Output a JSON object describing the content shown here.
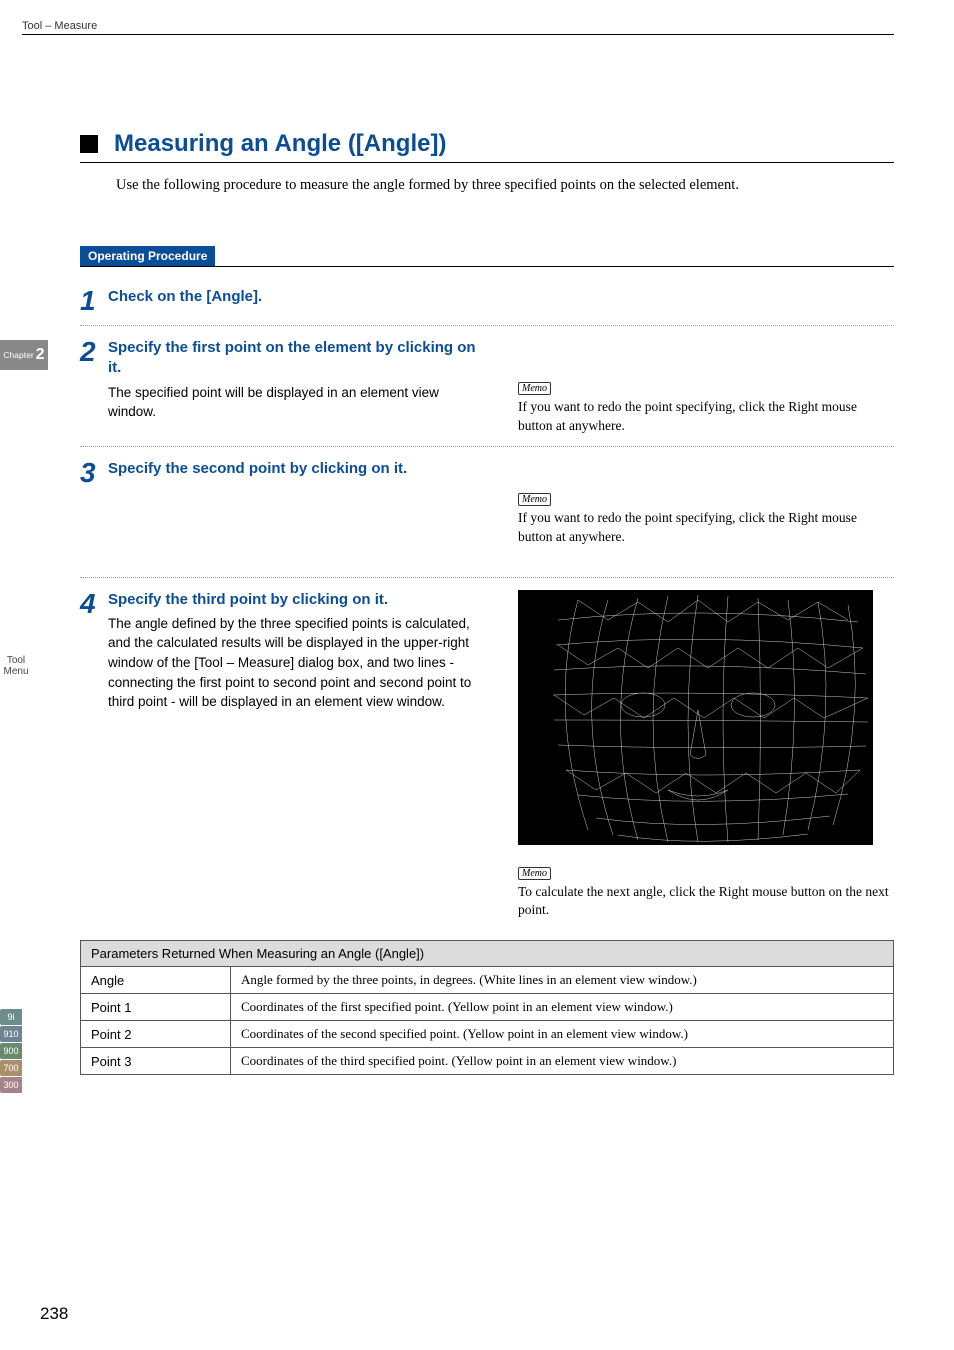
{
  "header": {
    "breadcrumb": "Tool – Measure"
  },
  "chapter_tab": {
    "label": "Chapter",
    "num": "2"
  },
  "side": {
    "menu_line1": "Tool",
    "menu_line2": "Menu",
    "tabs": [
      "9i",
      "910",
      "900",
      "700",
      "300"
    ]
  },
  "section": {
    "title": "Measuring an Angle ([Angle])"
  },
  "intro": "Use the following procedure to measure the angle formed by three specified points on the selected element.",
  "op_proc_label": "Operating Procedure",
  "memo_label": "Memo",
  "steps": [
    {
      "num": "1",
      "title": "Check on the [Angle].",
      "text": "",
      "memo": ""
    },
    {
      "num": "2",
      "title": "Specify the first point on the element by clicking on it.",
      "text": "The specified point will be displayed in an element view window.",
      "memo": "If you want to redo the point specifying, click the Right mouse button at anywhere."
    },
    {
      "num": "3",
      "title": "Specify the second point by clicking on it.",
      "text": "",
      "memo": "If you want to redo the point specifying, click the Right mouse button at anywhere."
    },
    {
      "num": "4",
      "title": "Specify the third point by clicking on it.",
      "text": "The angle defined by the three specified points is calculated, and the calculated results will be displayed in the upper-right window of the [Tool – Measure] dialog box, and two lines - connecting the first point to second point and second point to third point - will be displayed in an element view window.",
      "memo": "To calculate the next angle, click the Right mouse button on the next point."
    }
  ],
  "table": {
    "header": "Parameters Returned When Measuring an Angle ([Angle])",
    "rows": [
      {
        "label": "Angle",
        "desc": "Angle formed by the three points, in degrees. (White lines in an element view window.)"
      },
      {
        "label": "Point 1",
        "desc": "Coordinates of the first specified point. (Yellow point in an element view window.)"
      },
      {
        "label": "Point 2",
        "desc": "Coordinates of the second specified point. (Yellow point in an element view window.)"
      },
      {
        "label": "Point 3",
        "desc": "Coordinates of the third specified point. (Yellow point in an element view window.)"
      }
    ]
  },
  "page_number": "238"
}
